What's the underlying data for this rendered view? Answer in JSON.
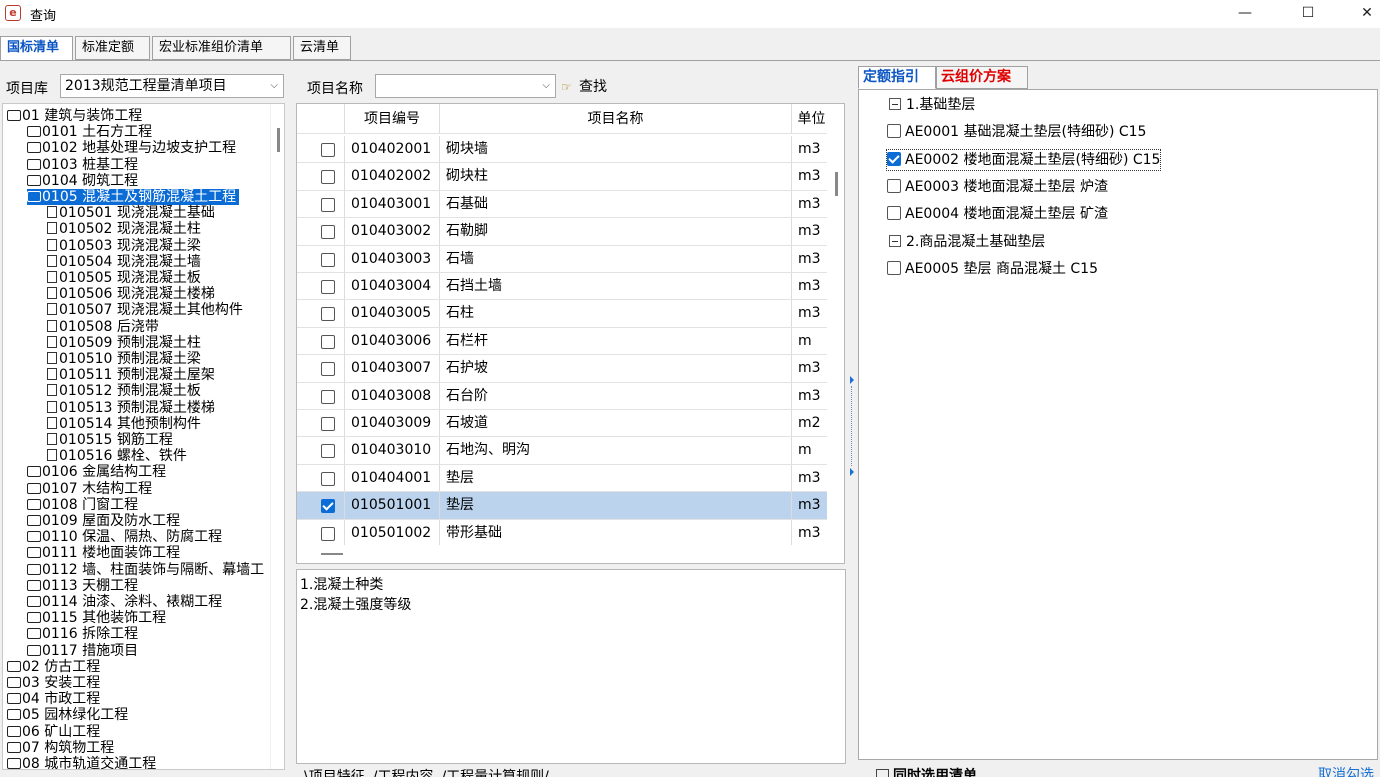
{
  "window": {
    "title": "查询",
    "app_icon": "e-icon",
    "minimize": "—",
    "maximize": "☐",
    "close": "✕"
  },
  "top_tabs": [
    "国标清单",
    "标准定额",
    "宏业标准组价清单",
    "云清单"
  ],
  "filters": {
    "library_label": "项目库",
    "library_value": "2013规范工程量清单项目",
    "name_label": "项目名称",
    "name_value": "",
    "find_label": "查找"
  },
  "tree": [
    {
      "text": "01 建筑与装饰工程",
      "indent": 0,
      "icon": "folder-open"
    },
    {
      "text": "0101 土石方工程",
      "indent": 1,
      "icon": "folder"
    },
    {
      "text": "0102 地基处理与边坡支护工程",
      "indent": 1,
      "icon": "folder"
    },
    {
      "text": "0103 桩基工程",
      "indent": 1,
      "icon": "folder"
    },
    {
      "text": "0104 砌筑工程",
      "indent": 1,
      "icon": "folder"
    },
    {
      "text": "0105 混凝土及钢筋混凝土工程",
      "indent": 1,
      "icon": "folder-open",
      "selected": true
    },
    {
      "text": "010501 现浇混凝土基础",
      "indent": 2,
      "icon": "doc"
    },
    {
      "text": "010502 现浇混凝土柱",
      "indent": 2,
      "icon": "doc"
    },
    {
      "text": "010503 现浇混凝土梁",
      "indent": 2,
      "icon": "doc"
    },
    {
      "text": "010504 现浇混凝土墙",
      "indent": 2,
      "icon": "doc"
    },
    {
      "text": "010505 现浇混凝土板",
      "indent": 2,
      "icon": "doc"
    },
    {
      "text": "010506 现浇混凝土楼梯",
      "indent": 2,
      "icon": "doc"
    },
    {
      "text": "010507 现浇混凝土其他构件",
      "indent": 2,
      "icon": "doc"
    },
    {
      "text": "010508 后浇带",
      "indent": 2,
      "icon": "doc"
    },
    {
      "text": "010509 预制混凝土柱",
      "indent": 2,
      "icon": "doc"
    },
    {
      "text": "010510 预制混凝土梁",
      "indent": 2,
      "icon": "doc"
    },
    {
      "text": "010511 预制混凝土屋架",
      "indent": 2,
      "icon": "doc"
    },
    {
      "text": "010512 预制混凝土板",
      "indent": 2,
      "icon": "doc"
    },
    {
      "text": "010513 预制混凝土楼梯",
      "indent": 2,
      "icon": "doc"
    },
    {
      "text": "010514 其他预制构件",
      "indent": 2,
      "icon": "doc"
    },
    {
      "text": "010515 钢筋工程",
      "indent": 2,
      "icon": "doc"
    },
    {
      "text": "010516 螺栓、铁件",
      "indent": 2,
      "icon": "doc"
    },
    {
      "text": "0106 金属结构工程",
      "indent": 1,
      "icon": "folder"
    },
    {
      "text": "0107 木结构工程",
      "indent": 1,
      "icon": "folder"
    },
    {
      "text": "0108 门窗工程",
      "indent": 1,
      "icon": "folder"
    },
    {
      "text": "0109 屋面及防水工程",
      "indent": 1,
      "icon": "folder"
    },
    {
      "text": "0110 保温、隔热、防腐工程",
      "indent": 1,
      "icon": "folder"
    },
    {
      "text": "0111 楼地面装饰工程",
      "indent": 1,
      "icon": "folder"
    },
    {
      "text": "0112 墙、柱面装饰与隔断、幕墙工",
      "indent": 1,
      "icon": "folder"
    },
    {
      "text": "0113 天棚工程",
      "indent": 1,
      "icon": "folder"
    },
    {
      "text": "0114 油漆、涂料、裱糊工程",
      "indent": 1,
      "icon": "folder"
    },
    {
      "text": "0115 其他装饰工程",
      "indent": 1,
      "icon": "folder"
    },
    {
      "text": "0116 拆除工程",
      "indent": 1,
      "icon": "folder"
    },
    {
      "text": "0117 措施项目",
      "indent": 1,
      "icon": "folder"
    },
    {
      "text": "02 仿古工程",
      "indent": 0,
      "icon": "folder"
    },
    {
      "text": "03 安装工程",
      "indent": 0,
      "icon": "folder"
    },
    {
      "text": "04 市政工程",
      "indent": 0,
      "icon": "folder"
    },
    {
      "text": "05 园林绿化工程",
      "indent": 0,
      "icon": "folder"
    },
    {
      "text": "06 矿山工程",
      "indent": 0,
      "icon": "folder"
    },
    {
      "text": "07 构筑物工程",
      "indent": 0,
      "icon": "folder"
    },
    {
      "text": "08 城市轨道交通工程",
      "indent": 0,
      "icon": "folder"
    }
  ],
  "grid": {
    "headers": [
      "项目编号",
      "项目名称",
      "单位"
    ],
    "rows": [
      {
        "code": "010402001",
        "name": "砌块墙",
        "unit": "m3",
        "checked": false
      },
      {
        "code": "010402002",
        "name": "砌块柱",
        "unit": "m3",
        "checked": false
      },
      {
        "code": "010403001",
        "name": "石基础",
        "unit": "m3",
        "checked": false
      },
      {
        "code": "010403002",
        "name": "石勒脚",
        "unit": "m3",
        "checked": false
      },
      {
        "code": "010403003",
        "name": "石墙",
        "unit": "m3",
        "checked": false
      },
      {
        "code": "010403004",
        "name": "石挡土墙",
        "unit": "m3",
        "checked": false
      },
      {
        "code": "010403005",
        "name": "石柱",
        "unit": "m3",
        "checked": false
      },
      {
        "code": "010403006",
        "name": "石栏杆",
        "unit": "m",
        "checked": false
      },
      {
        "code": "010403007",
        "name": "石护坡",
        "unit": "m3",
        "checked": false
      },
      {
        "code": "010403008",
        "name": "石台阶",
        "unit": "m3",
        "checked": false
      },
      {
        "code": "010403009",
        "name": "石坡道",
        "unit": "m2",
        "checked": false
      },
      {
        "code": "010403010",
        "name": "石地沟、明沟",
        "unit": "m",
        "checked": false
      },
      {
        "code": "010404001",
        "name": "垫层",
        "unit": "m3",
        "checked": false
      },
      {
        "code": "010501001",
        "name": "垫层",
        "unit": "m3",
        "checked": true,
        "selected": true
      },
      {
        "code": "010501002",
        "name": "带形基础",
        "unit": "m3",
        "checked": false
      }
    ]
  },
  "features": [
    "1.混凝土种类",
    "2.混凝土强度等级"
  ],
  "bottom_tabs": [
    "项目特征",
    "工程内容",
    "工程量计算规则"
  ],
  "right_tabs": [
    "定额指引",
    "云组价方案"
  ],
  "guide_tree": [
    {
      "type": "group",
      "text": "1.基础垫层"
    },
    {
      "type": "item",
      "text": "AE0001 基础混凝土垫层(特细砂) C15",
      "checked": false
    },
    {
      "type": "item",
      "text": "AE0002 楼地面混凝土垫层(特细砂) C15",
      "checked": true,
      "focus": true
    },
    {
      "type": "item",
      "text": "AE0003 楼地面混凝土垫层 炉渣",
      "checked": false
    },
    {
      "type": "item",
      "text": "AE0004 楼地面混凝土垫层 矿渣",
      "checked": false
    },
    {
      "type": "group",
      "text": "2.商品混凝土基础垫层"
    },
    {
      "type": "item",
      "text": "AE0005 垫层 商品混凝土 C15",
      "checked": false
    }
  ],
  "right_bottom": {
    "also_select_label": "同时选用清单",
    "cancel_label": "取消勾选"
  },
  "colors": {
    "accent": "#0b6cd6",
    "red_tab": "#e00000",
    "selected_row": "#bcd3ee"
  }
}
